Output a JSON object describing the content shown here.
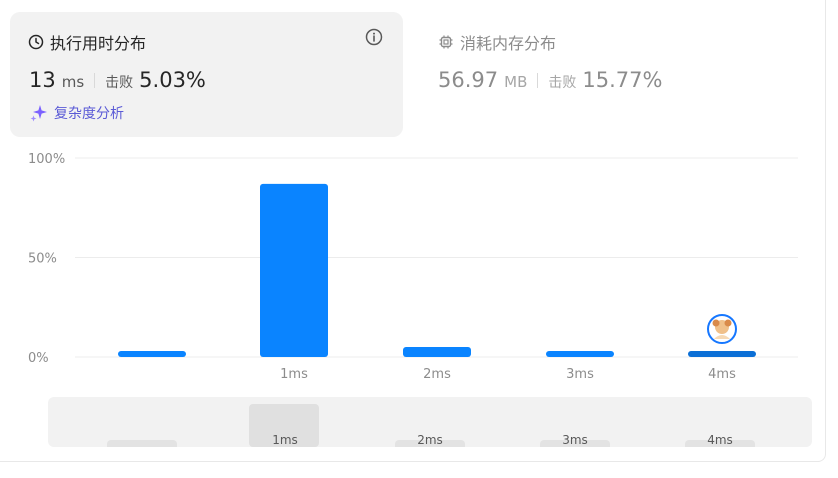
{
  "runtime": {
    "title": "执行用时分布",
    "value": "13",
    "unit": "ms",
    "beat_label": "击败",
    "beat_value": "5.03%",
    "complexity_link": "复杂度分析"
  },
  "memory": {
    "title": "消耗内存分布",
    "value": "56.97",
    "unit": "MB",
    "beat_label": "击败",
    "beat_value": "15.77%"
  },
  "colors": {
    "bar": "#0a84ff",
    "bar_active": "#0b6fd6",
    "grid": "#ececec",
    "link": "#5b5bd6"
  },
  "chart_data": {
    "type": "bar",
    "categories": [
      "",
      "1ms",
      "2ms",
      "3ms",
      "4ms"
    ],
    "values": [
      3,
      87,
      5,
      3,
      3
    ],
    "ylim": [
      0,
      100
    ],
    "yticks": [
      "0%",
      "50%",
      "100%"
    ],
    "highlight_index": 4,
    "grid": true
  },
  "minimap": {
    "labels": [
      "1ms",
      "2ms",
      "3ms",
      "4ms"
    ]
  }
}
